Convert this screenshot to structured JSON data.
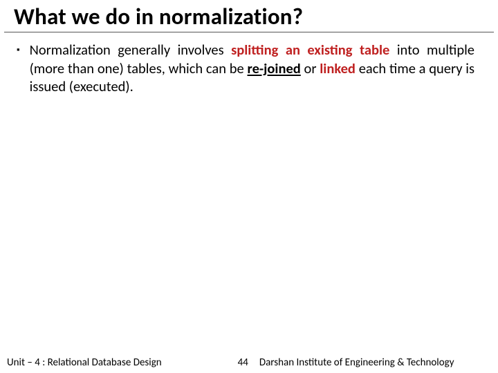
{
  "title": "What we do in normalization?",
  "bullet": {
    "seg1": "Normalization generally involves ",
    "seg2_red": "splitting an existing table",
    "seg3": " into multiple (more than one) tables, which can be ",
    "seg4_black_u": "re-joined",
    "seg5": " or ",
    "seg6_red": "linked",
    "seg7": " each time a query is issued (executed)."
  },
  "footer": {
    "unit": "Unit – 4 : Relational Database Design",
    "page": "44",
    "institute": "Darshan Institute of Engineering & Technology"
  }
}
